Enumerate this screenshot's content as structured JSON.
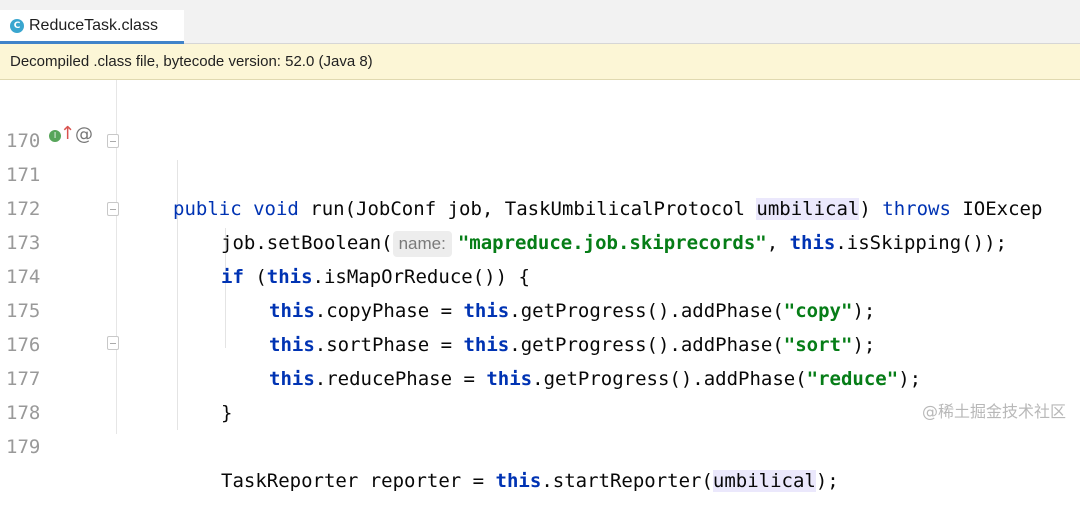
{
  "tab": {
    "icon_letter": "C",
    "label": "ReduceTask.class"
  },
  "banner": {
    "text": "Decompiled .class file, bytecode version: 52.0 (Java 8)"
  },
  "lines": [
    {
      "n": "170"
    },
    {
      "n": "171"
    },
    {
      "n": "172"
    },
    {
      "n": "173"
    },
    {
      "n": "174"
    },
    {
      "n": "175"
    },
    {
      "n": "176"
    },
    {
      "n": "177"
    },
    {
      "n": "178"
    },
    {
      "n": "179"
    }
  ],
  "code": {
    "l171": {
      "kw1": "public",
      "kw2": "void",
      "t1": " run(JobConf job, TaskUmbilicalProtocol ",
      "hl": "umbilical",
      "t2": ") ",
      "kw3": "throws",
      "t3": " IOExcep"
    },
    "l172": {
      "t1": "job.setBoolean(",
      "hint": "name:",
      "str": "\"mapreduce.job.skiprecords\"",
      "t2": ", ",
      "kw": "this",
      "t3": ".isSkipping());"
    },
    "l173": {
      "kw1": "if",
      "t1": " (",
      "kw2": "this",
      "t2": ".isMapOrReduce()) {"
    },
    "l174": {
      "kw1": "this",
      "t1": ".copyPhase = ",
      "kw2": "this",
      "t2": ".getProgress().addPhase(",
      "str": "\"copy\"",
      "t3": ");"
    },
    "l175": {
      "kw1": "this",
      "t1": ".sortPhase = ",
      "kw2": "this",
      "t2": ".getProgress().addPhase(",
      "str": "\"sort\"",
      "t3": ");"
    },
    "l176": {
      "kw1": "this",
      "t1": ".reducePhase = ",
      "kw2": "this",
      "t2": ".getProgress().addPhase(",
      "str": "\"reduce\"",
      "t3": ");"
    },
    "l177": {
      "t1": "}"
    },
    "l179": {
      "t1": "TaskReporter reporter = ",
      "kw": "this",
      "t2": ".startReporter(",
      "hl": "umbilical",
      "t3": ");"
    }
  },
  "watermark": "@稀土掘金技术社区",
  "colors": {
    "keyword": "#0033b3",
    "string": "#067d17",
    "highlight": "#ebe8fc",
    "banner_bg": "#fcf6d6",
    "tab_underline": "#4083c9"
  },
  "icons": [
    "class-file-icon",
    "implements-icon",
    "override-up-arrow-icon",
    "annotation-at-icon",
    "fold-marker-icon"
  ]
}
